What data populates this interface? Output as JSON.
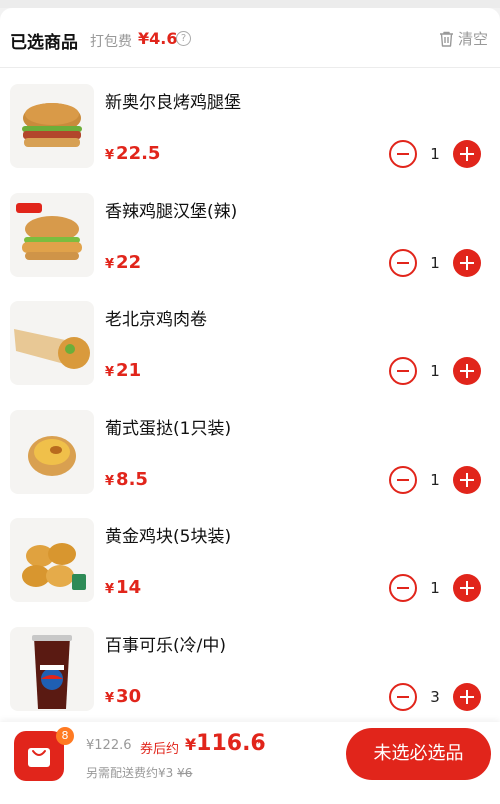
{
  "header": {
    "title": "已选商品",
    "pack_label": "打包费",
    "pack_price": "¥4.6",
    "help_glyph": "?",
    "clear_label": "清空"
  },
  "items": [
    {
      "name": "新奥尔良烤鸡腿堡",
      "currency": "¥",
      "price": "22.5",
      "qty": "1",
      "image": "burger-new-orleans"
    },
    {
      "name": "香辣鸡腿汉堡(辣)",
      "currency": "¥",
      "price": "22",
      "qty": "1",
      "image": "burger-spicy-chicken"
    },
    {
      "name": "老北京鸡肉卷",
      "currency": "¥",
      "price": "21",
      "qty": "1",
      "image": "chicken-wrap"
    },
    {
      "name": "葡式蛋挞(1只装)",
      "currency": "¥",
      "price": "8.5",
      "qty": "1",
      "image": "egg-tart"
    },
    {
      "name": "黄金鸡块(5块装)",
      "currency": "¥",
      "price": "14",
      "qty": "1",
      "image": "chicken-nuggets"
    },
    {
      "name": "百事可乐(冷/中)",
      "currency": "¥",
      "price": "30",
      "qty": "3",
      "image": "pepsi-cup"
    }
  ],
  "bottom": {
    "cart_count": "8",
    "original_total": "¥122.6",
    "after_coupon_label": "券后约",
    "final_currency": "¥",
    "final_total": "116.6",
    "caret": "^",
    "delivery_prefix": "另需配送费约",
    "delivery_fee": "¥3",
    "delivery_original": "¥6",
    "checkout_label": "未选必选品"
  },
  "colors": {
    "accent": "#e1251b",
    "badge": "#ff7a22",
    "muted": "#999999"
  },
  "icons": [
    "trash-icon",
    "help-icon",
    "minus-icon",
    "plus-icon",
    "shopping-bag-icon"
  ]
}
